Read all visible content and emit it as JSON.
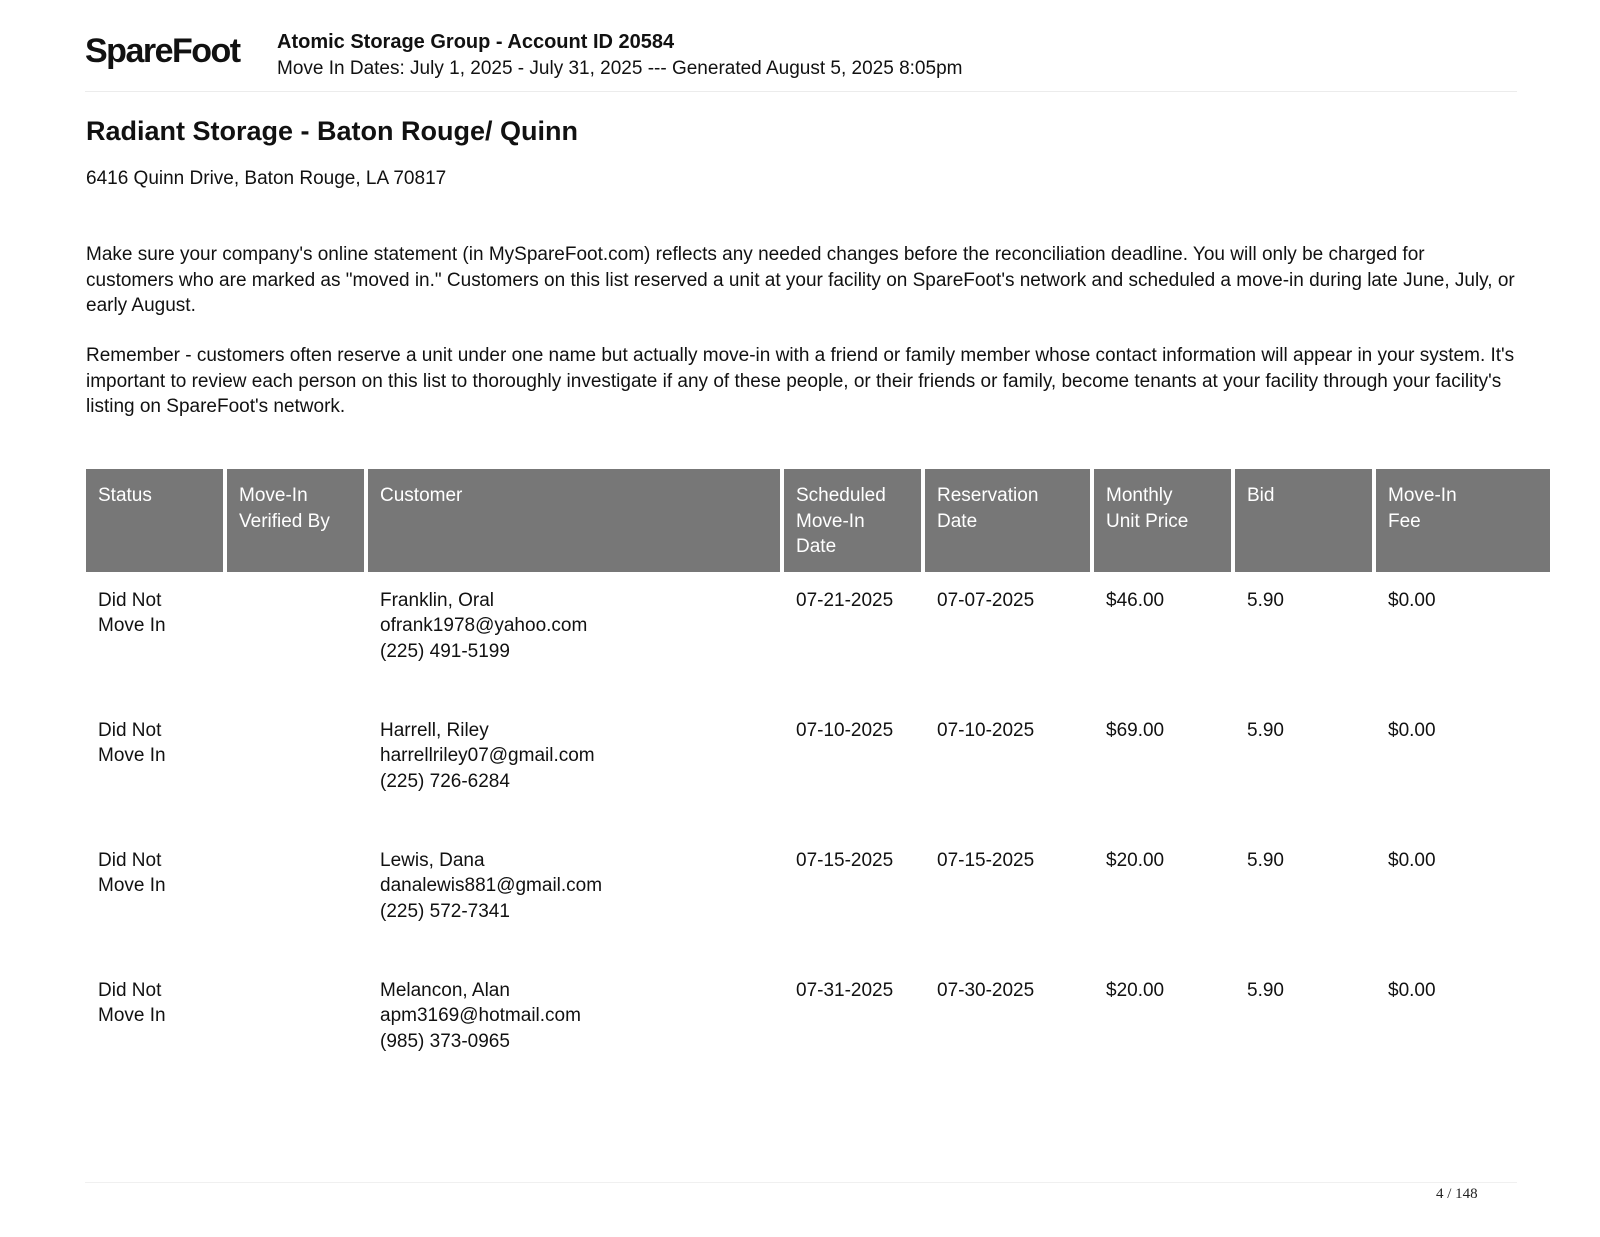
{
  "header": {
    "logo_text": "SpareFoot",
    "title": "Atomic Storage Group - Account ID 20584",
    "subtitle": "Move In Dates: July 1, 2025 - July 31, 2025 --- Generated August 5, 2025 8:05pm"
  },
  "facility": {
    "name": "Radiant Storage - Baton Rouge/ Quinn",
    "address": "6416 Quinn Drive, Baton Rouge, LA 70817"
  },
  "instructions": [
    "Make sure your company's online statement (in MySpareFoot.com) reflects any needed changes before the reconciliation deadline. You will only be charged for customers who are marked as \"moved in.\" Customers on this list reserved a unit at your facility on SpareFoot's network and scheduled a move-in during late June, July, or early August.",
    "Remember - customers often reserve a unit under one name but actually move-in with a friend or family member whose contact information will appear in your system. It's important to review each person on this list to thoroughly investigate if any of these people, or their friends or family, become tenants at your facility through your facility's listing on SpareFoot's network."
  ],
  "table": {
    "columns": [
      [
        "Status"
      ],
      [
        "Move-In",
        "Verified By"
      ],
      [
        "Customer"
      ],
      [
        "Scheduled",
        "Move-In",
        "Date"
      ],
      [
        "Reservation",
        "Date"
      ],
      [
        "Monthly",
        "Unit Price"
      ],
      [
        "Bid"
      ],
      [
        "Move-In",
        "Fee"
      ]
    ],
    "rows": [
      {
        "status": [
          "Did Not",
          "Move In"
        ],
        "verified_by": "",
        "customer_name": "Franklin, Oral",
        "customer_email": "ofrank1978@yahoo.com",
        "customer_phone": "(225) 491-5199",
        "scheduled_date": "07-21-2025",
        "reservation_date": "07-07-2025",
        "unit_price": "$46.00",
        "bid": "5.90",
        "move_in_fee": "$0.00"
      },
      {
        "status": [
          "Did Not",
          "Move In"
        ],
        "verified_by": "",
        "customer_name": "Harrell, Riley",
        "customer_email": "harrellriley07@gmail.com",
        "customer_phone": "(225) 726-6284",
        "scheduled_date": "07-10-2025",
        "reservation_date": "07-10-2025",
        "unit_price": "$69.00",
        "bid": "5.90",
        "move_in_fee": "$0.00"
      },
      {
        "status": [
          "Did Not",
          "Move In"
        ],
        "verified_by": "",
        "customer_name": "Lewis, Dana",
        "customer_email": "danalewis881@gmail.com",
        "customer_phone": "(225) 572-7341",
        "scheduled_date": "07-15-2025",
        "reservation_date": "07-15-2025",
        "unit_price": "$20.00",
        "bid": "5.90",
        "move_in_fee": "$0.00"
      },
      {
        "status": [
          "Did Not",
          "Move In"
        ],
        "verified_by": "",
        "customer_name": "Melancon, Alan",
        "customer_email": "apm3169@hotmail.com",
        "customer_phone": "(985) 373-0965",
        "scheduled_date": "07-31-2025",
        "reservation_date": "07-30-2025",
        "unit_price": "$20.00",
        "bid": "5.90",
        "move_in_fee": "$0.00"
      }
    ]
  },
  "footer": {
    "page_indicator": "4 / 148"
  }
}
